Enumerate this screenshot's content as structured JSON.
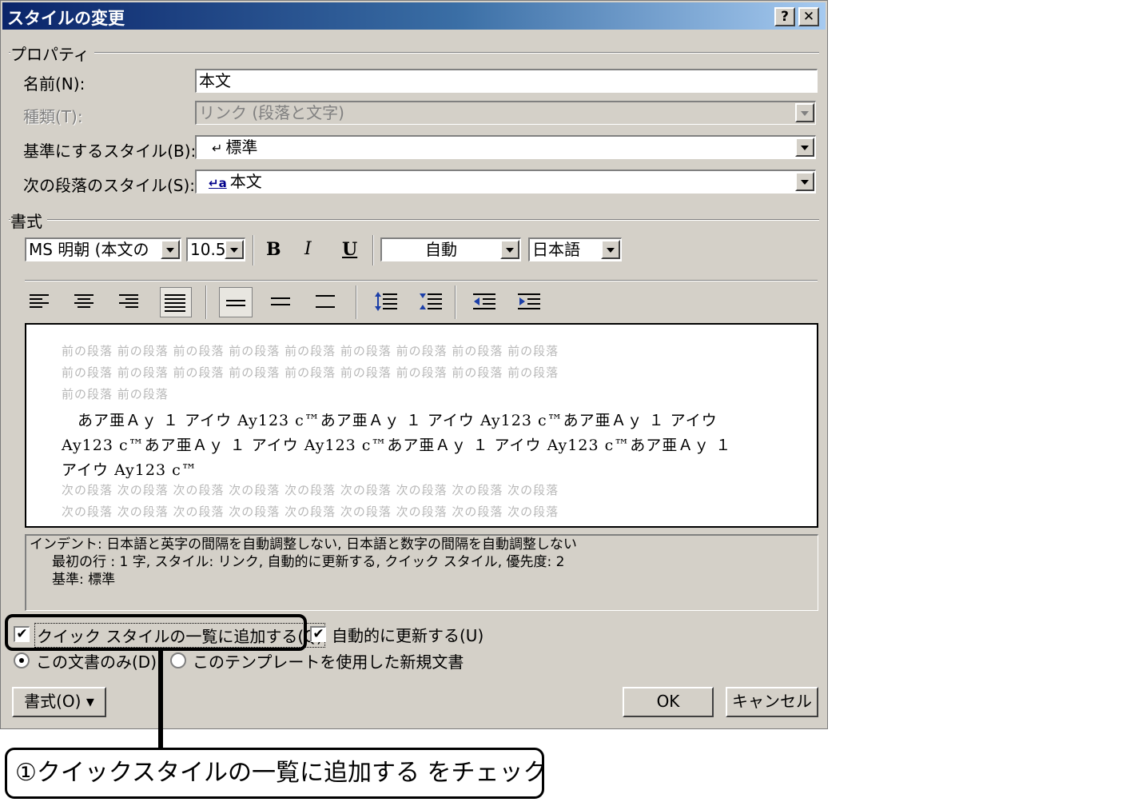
{
  "dialog": {
    "title": "スタイルの変更",
    "help_label": "?",
    "close_label": "✕"
  },
  "properties": {
    "group_label": "プロパティ",
    "name_label": "名前(N):",
    "name_value": "本文",
    "type_label": "種類(T):",
    "type_value": "リンク (段落と文字)",
    "base_label": "基準にするスタイル(B):",
    "base_value": "標準",
    "next_label": "次の段落のスタイル(S):",
    "next_mark": "a",
    "next_value": "本文"
  },
  "format": {
    "group_label": "書式",
    "font_value": "MS 明朝 (本文の",
    "size_value": "10.5",
    "bold_label": "B",
    "italic_label": "I",
    "underline_label": "U",
    "color_value": "自動",
    "language_value": "日本語"
  },
  "preview": {
    "prev_lines": [
      "前の段落 前の段落 前の段落 前の段落 前の段落 前の段落 前の段落 前の段落 前の段落",
      "前の段落 前の段落 前の段落 前の段落 前の段落 前の段落 前の段落 前の段落 前の段落",
      "前の段落 前の段落"
    ],
    "sample_lines": [
      "　あア亜Ａｙ １ アイウ Ay123 c™あア亜Ａｙ １ アイウ Ay123 c™あア亜Ａｙ １ アイウ",
      "Ay123 c™あア亜Ａｙ １ アイウ Ay123 c™あア亜Ａｙ １ アイウ Ay123 c™あア亜Ａｙ １",
      "アイウ Ay123 c™"
    ],
    "next_lines": [
      "次の段落 次の段落 次の段落 次の段落 次の段落 次の段落 次の段落 次の段落 次の段落",
      "次の段落 次の段落 次の段落 次の段落 次の段落 次の段落 次の段落 次の段落 次の段落"
    ]
  },
  "description": {
    "line1": "インデント: 日本語と英字の間隔を自動調整しない, 日本語と数字の間隔を自動調整しない",
    "line2": "最初の行 :  1 字, スタイル: リンク, 自動的に更新する, クイック スタイル, 優先度: 2",
    "line3": "基準: 標準"
  },
  "options": {
    "quick_style_label": "クイック スタイルの一覧に追加する(Q)",
    "quick_style_checked": true,
    "auto_update_label": "自動的に更新する(U)",
    "auto_update_checked": true,
    "this_doc_label": "この文書のみ(D)",
    "template_label": "このテンプレートを使用した新規文書"
  },
  "buttons": {
    "format_label": "書式(O) ▾",
    "ok_label": "OK",
    "cancel_label": "キャンセル"
  },
  "callout": {
    "text": "①クイックスタイルの一覧に追加する をチェック"
  }
}
